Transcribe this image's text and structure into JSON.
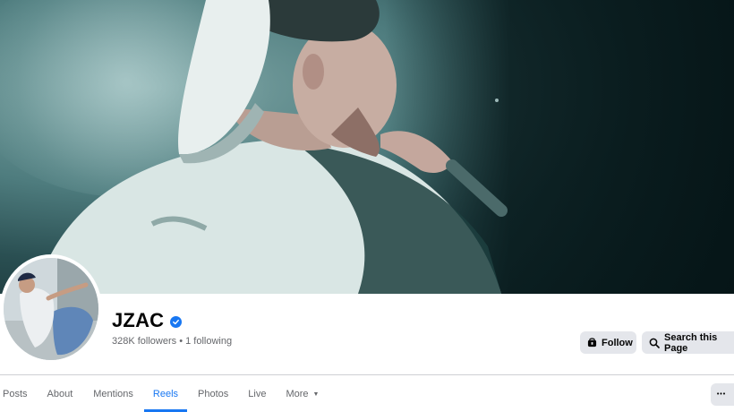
{
  "page": {
    "name": "JZAC",
    "stats": "328K followers • 1 following",
    "verified": true
  },
  "actions": {
    "follow_label": "Follow",
    "search_label": "Search this Page",
    "more_label": "•••"
  },
  "tabs": [
    {
      "label": "Posts",
      "active": false
    },
    {
      "label": "About",
      "active": false
    },
    {
      "label": "Mentions",
      "active": false
    },
    {
      "label": "Reels",
      "active": true
    },
    {
      "label": "Photos",
      "active": false
    },
    {
      "label": "Live",
      "active": false
    },
    {
      "label": "More",
      "active": false
    }
  ],
  "colors": {
    "accent": "#1877f2",
    "button_bg": "#e4e6eb",
    "muted_text": "#65676b"
  },
  "icons": {
    "verified": "verified-badge-icon",
    "follow": "follow-icon",
    "search": "search-icon",
    "more_chevron": "chevron-down-icon",
    "more_dots": "more-dots-icon"
  }
}
